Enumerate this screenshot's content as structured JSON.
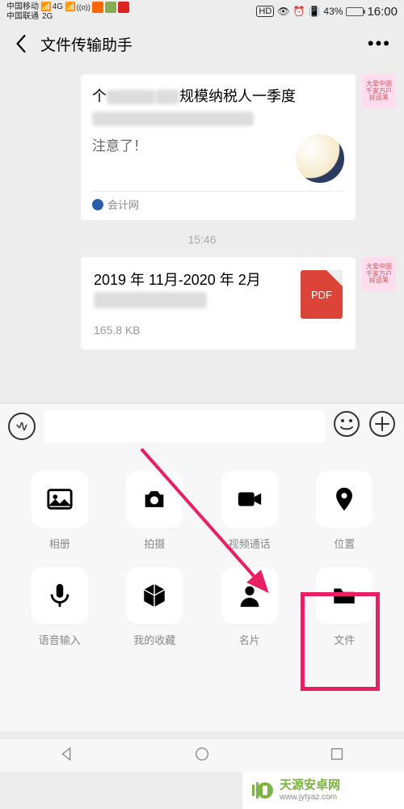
{
  "status": {
    "carrier1": "中国移动",
    "carrier2": "中国联通",
    "net1": "4G",
    "net2": "2G",
    "hd": "HD",
    "battery_pct": "43%",
    "time": "16:00"
  },
  "header": {
    "title": "文件传输助手"
  },
  "chat": {
    "article": {
      "title_part1": "个",
      "title_part2": "规模纳税人一季度",
      "subtitle": "注意了！",
      "source": "会计网"
    },
    "timestamp": "15:46",
    "file": {
      "name_line1": "2019 年 11月-2020 年 2月",
      "size": "165.8 KB",
      "ext": "PDF"
    },
    "avatar_text": "大爱中国\n千家万户\n好运来"
  },
  "attachments": [
    {
      "key": "album",
      "label": "相册"
    },
    {
      "key": "camera",
      "label": "拍摄"
    },
    {
      "key": "video",
      "label": "视频通话"
    },
    {
      "key": "location",
      "label": "位置"
    },
    {
      "key": "voice",
      "label": "语音输入"
    },
    {
      "key": "fav",
      "label": "我的收藏"
    },
    {
      "key": "contact",
      "label": "名片"
    },
    {
      "key": "file",
      "label": "文件"
    }
  ],
  "watermark": {
    "name": "天源安卓网",
    "url": "www.jytyaz.com"
  }
}
